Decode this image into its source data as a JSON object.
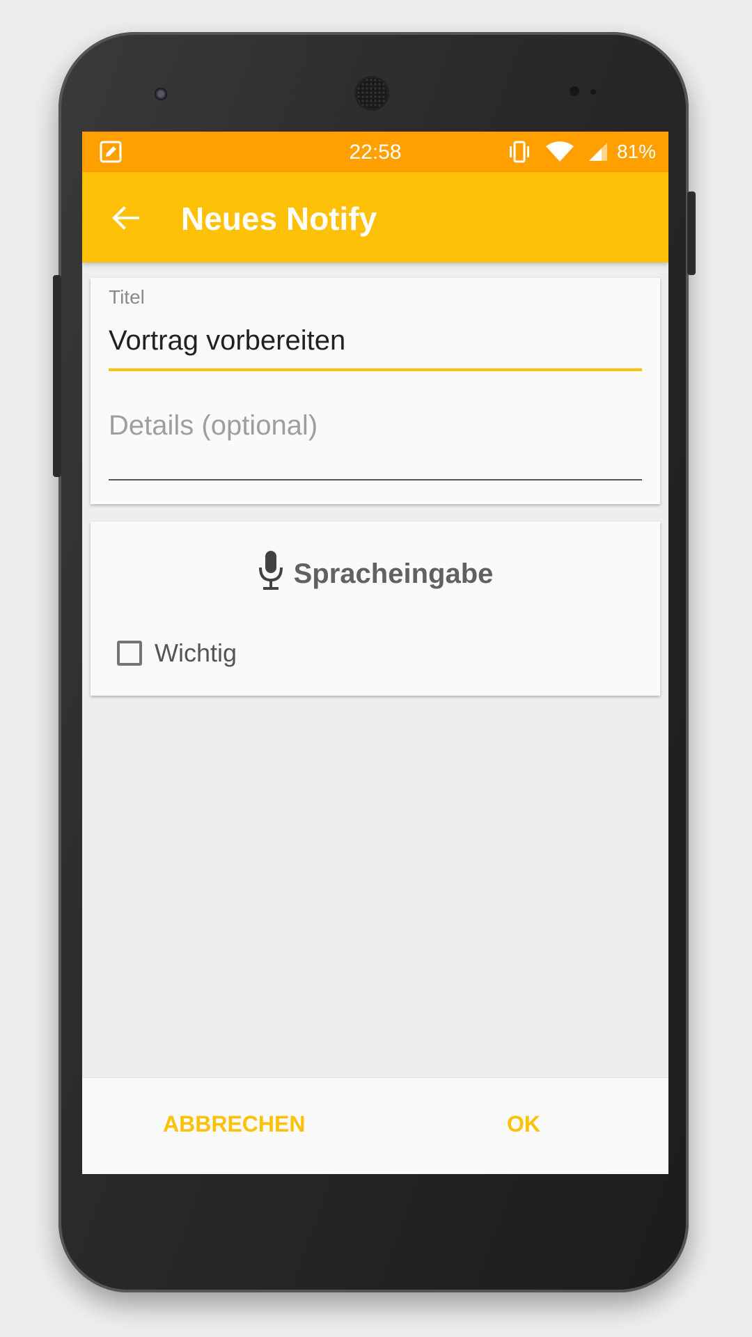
{
  "status_bar": {
    "time": "22:58",
    "battery": "81%",
    "icons": [
      "edit-note-icon",
      "vibrate-icon",
      "wifi-icon",
      "cell-signal-icon"
    ],
    "color": "#ffa000"
  },
  "app_bar": {
    "title": "Neues Notify",
    "back_icon": "arrow-back-icon",
    "color": "#ffc107"
  },
  "form": {
    "title_label": "Titel",
    "title_value": "Vortrag vorbereiten",
    "details_placeholder": "Details (optional)",
    "details_value": ""
  },
  "options": {
    "voice_input_label": "Spracheingabe",
    "voice_icon": "microphone-icon",
    "important_label": "Wichtig",
    "important_checked": false
  },
  "buttons": {
    "cancel_label": "ABBRECHEN",
    "ok_label": "OK",
    "accent": "#ffc107"
  }
}
